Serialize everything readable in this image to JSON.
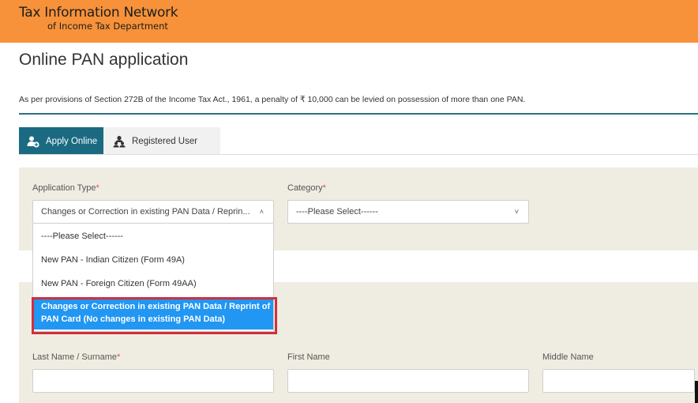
{
  "header": {
    "brand_line1": "Tax Information Network",
    "brand_line2": "of Income Tax Department",
    "bg_color": "#f7923a"
  },
  "page": {
    "title": "Online PAN application",
    "notice": "As per provisions of Section 272B of the Income Tax Act., 1961, a penalty of ₹ 10,000 can be levied on possession of more than one PAN."
  },
  "tabs": [
    {
      "label": "Apply Online",
      "icon": "add-user-icon",
      "active": true
    },
    {
      "label": "Registered User",
      "icon": "users-icon",
      "active": false
    }
  ],
  "form": {
    "application_type": {
      "label": "Application Type",
      "required_mark": "*",
      "value": "Changes or Correction in existing PAN Data / Reprin...",
      "options": [
        {
          "label": "----Please Select------"
        },
        {
          "label": "New PAN - Indian Citizen (Form 49A)"
        },
        {
          "label": "New PAN - Foreign Citizen (Form 49AA)"
        },
        {
          "label_line1": "Changes or Correction in existing PAN Data / Reprint of",
          "label_line2": "PAN Card (No changes in existing PAN Data)",
          "selected": true
        }
      ]
    },
    "category": {
      "label": "Category",
      "required_mark": "*",
      "value": "----Please Select------"
    },
    "last_name": {
      "label": "Last Name / Surname",
      "required_mark": "*"
    },
    "first_name": {
      "label": "First Name"
    },
    "middle_name": {
      "label": "Middle Name"
    }
  },
  "colors": {
    "tab_active": "#1a6a82",
    "selected_option": "#2196f3",
    "highlight_border": "#d0303c",
    "panel_bg": "#efede1"
  }
}
